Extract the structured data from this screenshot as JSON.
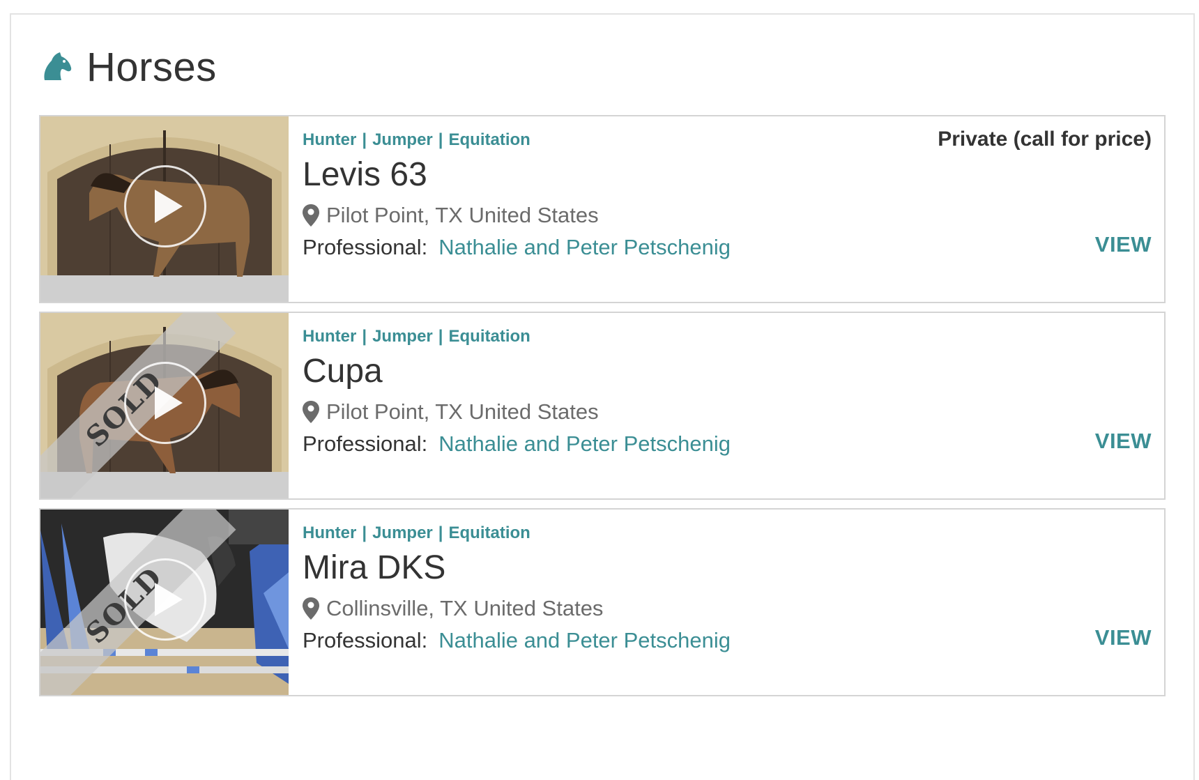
{
  "header": {
    "title": "Horses",
    "icon": "horse-head-icon",
    "accent": "#3b8e94"
  },
  "horses": [
    {
      "disciplines": [
        "Hunter",
        "Jumper",
        "Equitation"
      ],
      "name": "Levis 63",
      "location": "Pilot Point, TX United States",
      "professional_label": "Professional:",
      "professional": "Nathalie and Peter Petschenig",
      "price": "Private (call for price)",
      "view_label": "VIEW",
      "sold": false,
      "has_video": true
    },
    {
      "disciplines": [
        "Hunter",
        "Jumper",
        "Equitation"
      ],
      "name": "Cupa",
      "location": "Pilot Point, TX United States",
      "professional_label": "Professional:",
      "professional": "Nathalie and Peter Petschenig",
      "price": "",
      "view_label": "VIEW",
      "sold": true,
      "sold_label": "SOLD",
      "has_video": true
    },
    {
      "disciplines": [
        "Hunter",
        "Jumper",
        "Equitation"
      ],
      "name": "Mira DKS",
      "location": "Collinsville, TX United States",
      "professional_label": "Professional:",
      "professional": "Nathalie and Peter Petschenig",
      "price": "",
      "view_label": "VIEW",
      "sold": true,
      "sold_label": "SOLD",
      "has_video": true
    }
  ]
}
